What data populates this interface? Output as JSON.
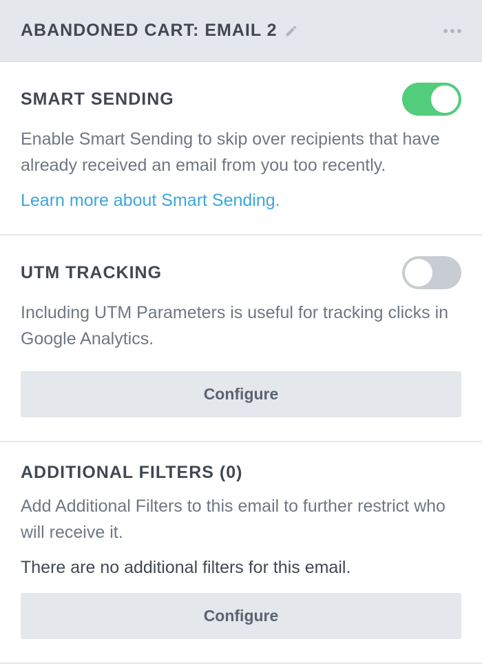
{
  "header": {
    "title": "ABANDONED CART: EMAIL 2"
  },
  "sections": {
    "smart_sending": {
      "title": "SMART SENDING",
      "desc": "Enable Smart Sending to skip over recipients that have already received an email from you too recently.",
      "link": "Learn more about Smart Sending.",
      "toggle": true
    },
    "utm_tracking": {
      "title": "UTM TRACKING",
      "desc": "Including UTM Parameters is useful for tracking clicks in Google Analytics.",
      "button": "Configure",
      "toggle": false
    },
    "filters": {
      "title": "ADDITIONAL FILTERS (0)",
      "desc": "Add Additional Filters to this email to further restrict who will receive it.",
      "status": "There are no additional filters for this email.",
      "button": "Configure"
    }
  }
}
